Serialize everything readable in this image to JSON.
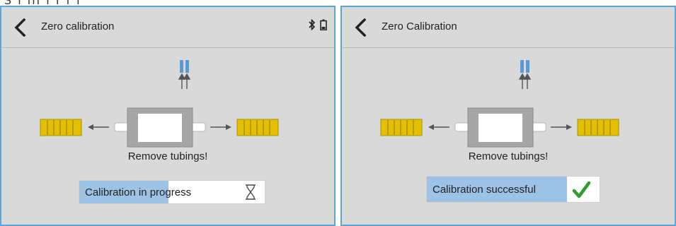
{
  "top_strip_text": "S                               l             ill          i                          f                   f   l",
  "screens": [
    {
      "title": "Zero calibration",
      "status_icons": [
        "bluetooth-icon",
        "battery-icon"
      ],
      "instruction": "Remove tubings!",
      "status_text": "Calibration in progress",
      "status_icon": "hourglass-icon",
      "progress": 0.48
    },
    {
      "title": "Zero Calibration",
      "status_icons": [],
      "instruction": "Remove tubings!",
      "status_text": "Calibration successful",
      "status_icon": "checkmark-icon",
      "progress": 1.0
    }
  ],
  "colors": {
    "panel_bg": "#d9d9d9",
    "panel_border": "#5aa6d6",
    "progress_fill": "#9cc2e5",
    "tubing_yellow": "#e5c000",
    "sensor_blue": "#5b9bd5",
    "check_green": "#2e9d2e"
  }
}
